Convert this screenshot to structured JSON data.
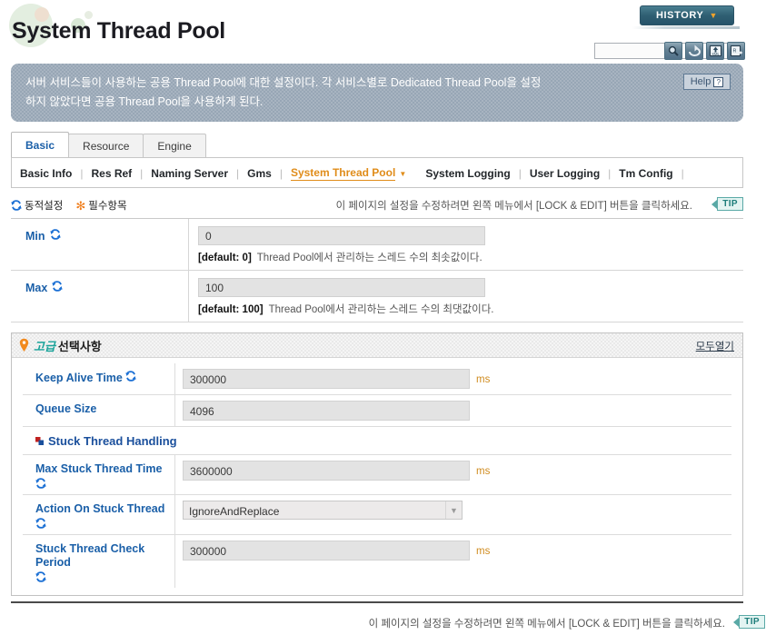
{
  "header": {
    "title": "System Thread Pool",
    "history_label": "HISTORY",
    "history_caret": "▼",
    "search_value": "",
    "search_placeholder": "",
    "tool_icons": [
      {
        "name": "search-icon",
        "title": "Search"
      },
      {
        "name": "reload-icon",
        "title": "Reload"
      },
      {
        "name": "xml-export-icon",
        "title": "XML Export"
      },
      {
        "name": "report-export-icon",
        "title": "Report Export"
      }
    ]
  },
  "description": {
    "line1": "서버 서비스들이 사용하는 공용 Thread Pool에 대한 설정이다. 각 서비스별로 Dedicated Thread Pool을 설정",
    "line2": "하지 않았다면 공용 Thread Pool을 사용하게 된다.",
    "help_label": "Help",
    "help_mark": "?"
  },
  "tabs": [
    {
      "label": "Basic",
      "active": true
    },
    {
      "label": "Resource",
      "active": false
    },
    {
      "label": "Engine",
      "active": false
    }
  ],
  "subnav": {
    "items": [
      {
        "label": "Basic Info",
        "current": false
      },
      {
        "label": "Res Ref",
        "current": false
      },
      {
        "label": "Naming Server",
        "current": false
      },
      {
        "label": "Gms",
        "current": false
      },
      {
        "label": "System Thread Pool",
        "current": true
      },
      {
        "label": "System Logging",
        "current": false
      },
      {
        "label": "User Logging",
        "current": false
      },
      {
        "label": "Tm Config",
        "current": false
      }
    ],
    "separator": "|",
    "current_caret": "▼"
  },
  "legend": {
    "dynamic_label": "동적설정",
    "required_label": "필수항목",
    "required_mark": "✻",
    "hint": "이 페이지의 설정을 수정하려면 왼쪽 메뉴에서 [LOCK & EDIT] 버튼을 클릭하세요.",
    "tip_label": "TIP"
  },
  "basic_fields": [
    {
      "label": "Min",
      "dynamic": true,
      "value": "0",
      "hint_default": "[default: 0]",
      "hint_desc": "Thread Pool에서 관리하는 스레드 수의 최솟값이다."
    },
    {
      "label": "Max",
      "dynamic": true,
      "value": "100",
      "hint_default": "[default: 100]",
      "hint_desc": "Thread Pool에서 관리하는 스레드 수의 최댓값이다."
    }
  ],
  "advanced": {
    "title_korean": "고급",
    "title_rest": "선택사항",
    "open_all_label": "모두열기",
    "rows": [
      {
        "label": "Keep Alive Time",
        "dynamic": true,
        "type": "text",
        "value": "300000",
        "unit": "ms"
      },
      {
        "label": "Queue Size",
        "dynamic": false,
        "type": "text",
        "value": "4096",
        "unit": ""
      }
    ],
    "stuck_section": {
      "title": "Stuck Thread Handling",
      "rows": [
        {
          "label": "Max Stuck Thread Time",
          "dynamic": true,
          "type": "text",
          "value": "3600000",
          "unit": "ms"
        },
        {
          "label": "Action On Stuck Thread",
          "dynamic": true,
          "type": "select",
          "value": "IgnoreAndReplace",
          "unit": ""
        },
        {
          "label": "Stuck Thread Check Period",
          "dynamic": true,
          "type": "text",
          "value": "300000",
          "unit": "ms"
        }
      ]
    }
  },
  "footer": {
    "hint": "이 페이지의 설정을 수정하려면 왼쪽 메뉴에서 [LOCK & EDIT] 버튼을 클릭하세요.",
    "tip_label": "TIP"
  },
  "colors": {
    "accent_blue": "#1a5fa8",
    "accent_orange": "#e08c19",
    "banner_gray": "#97a6b5",
    "history_teal": "#2f5f72",
    "unit_amber": "#d08c20",
    "teal_tip": "#1d7d7a"
  }
}
